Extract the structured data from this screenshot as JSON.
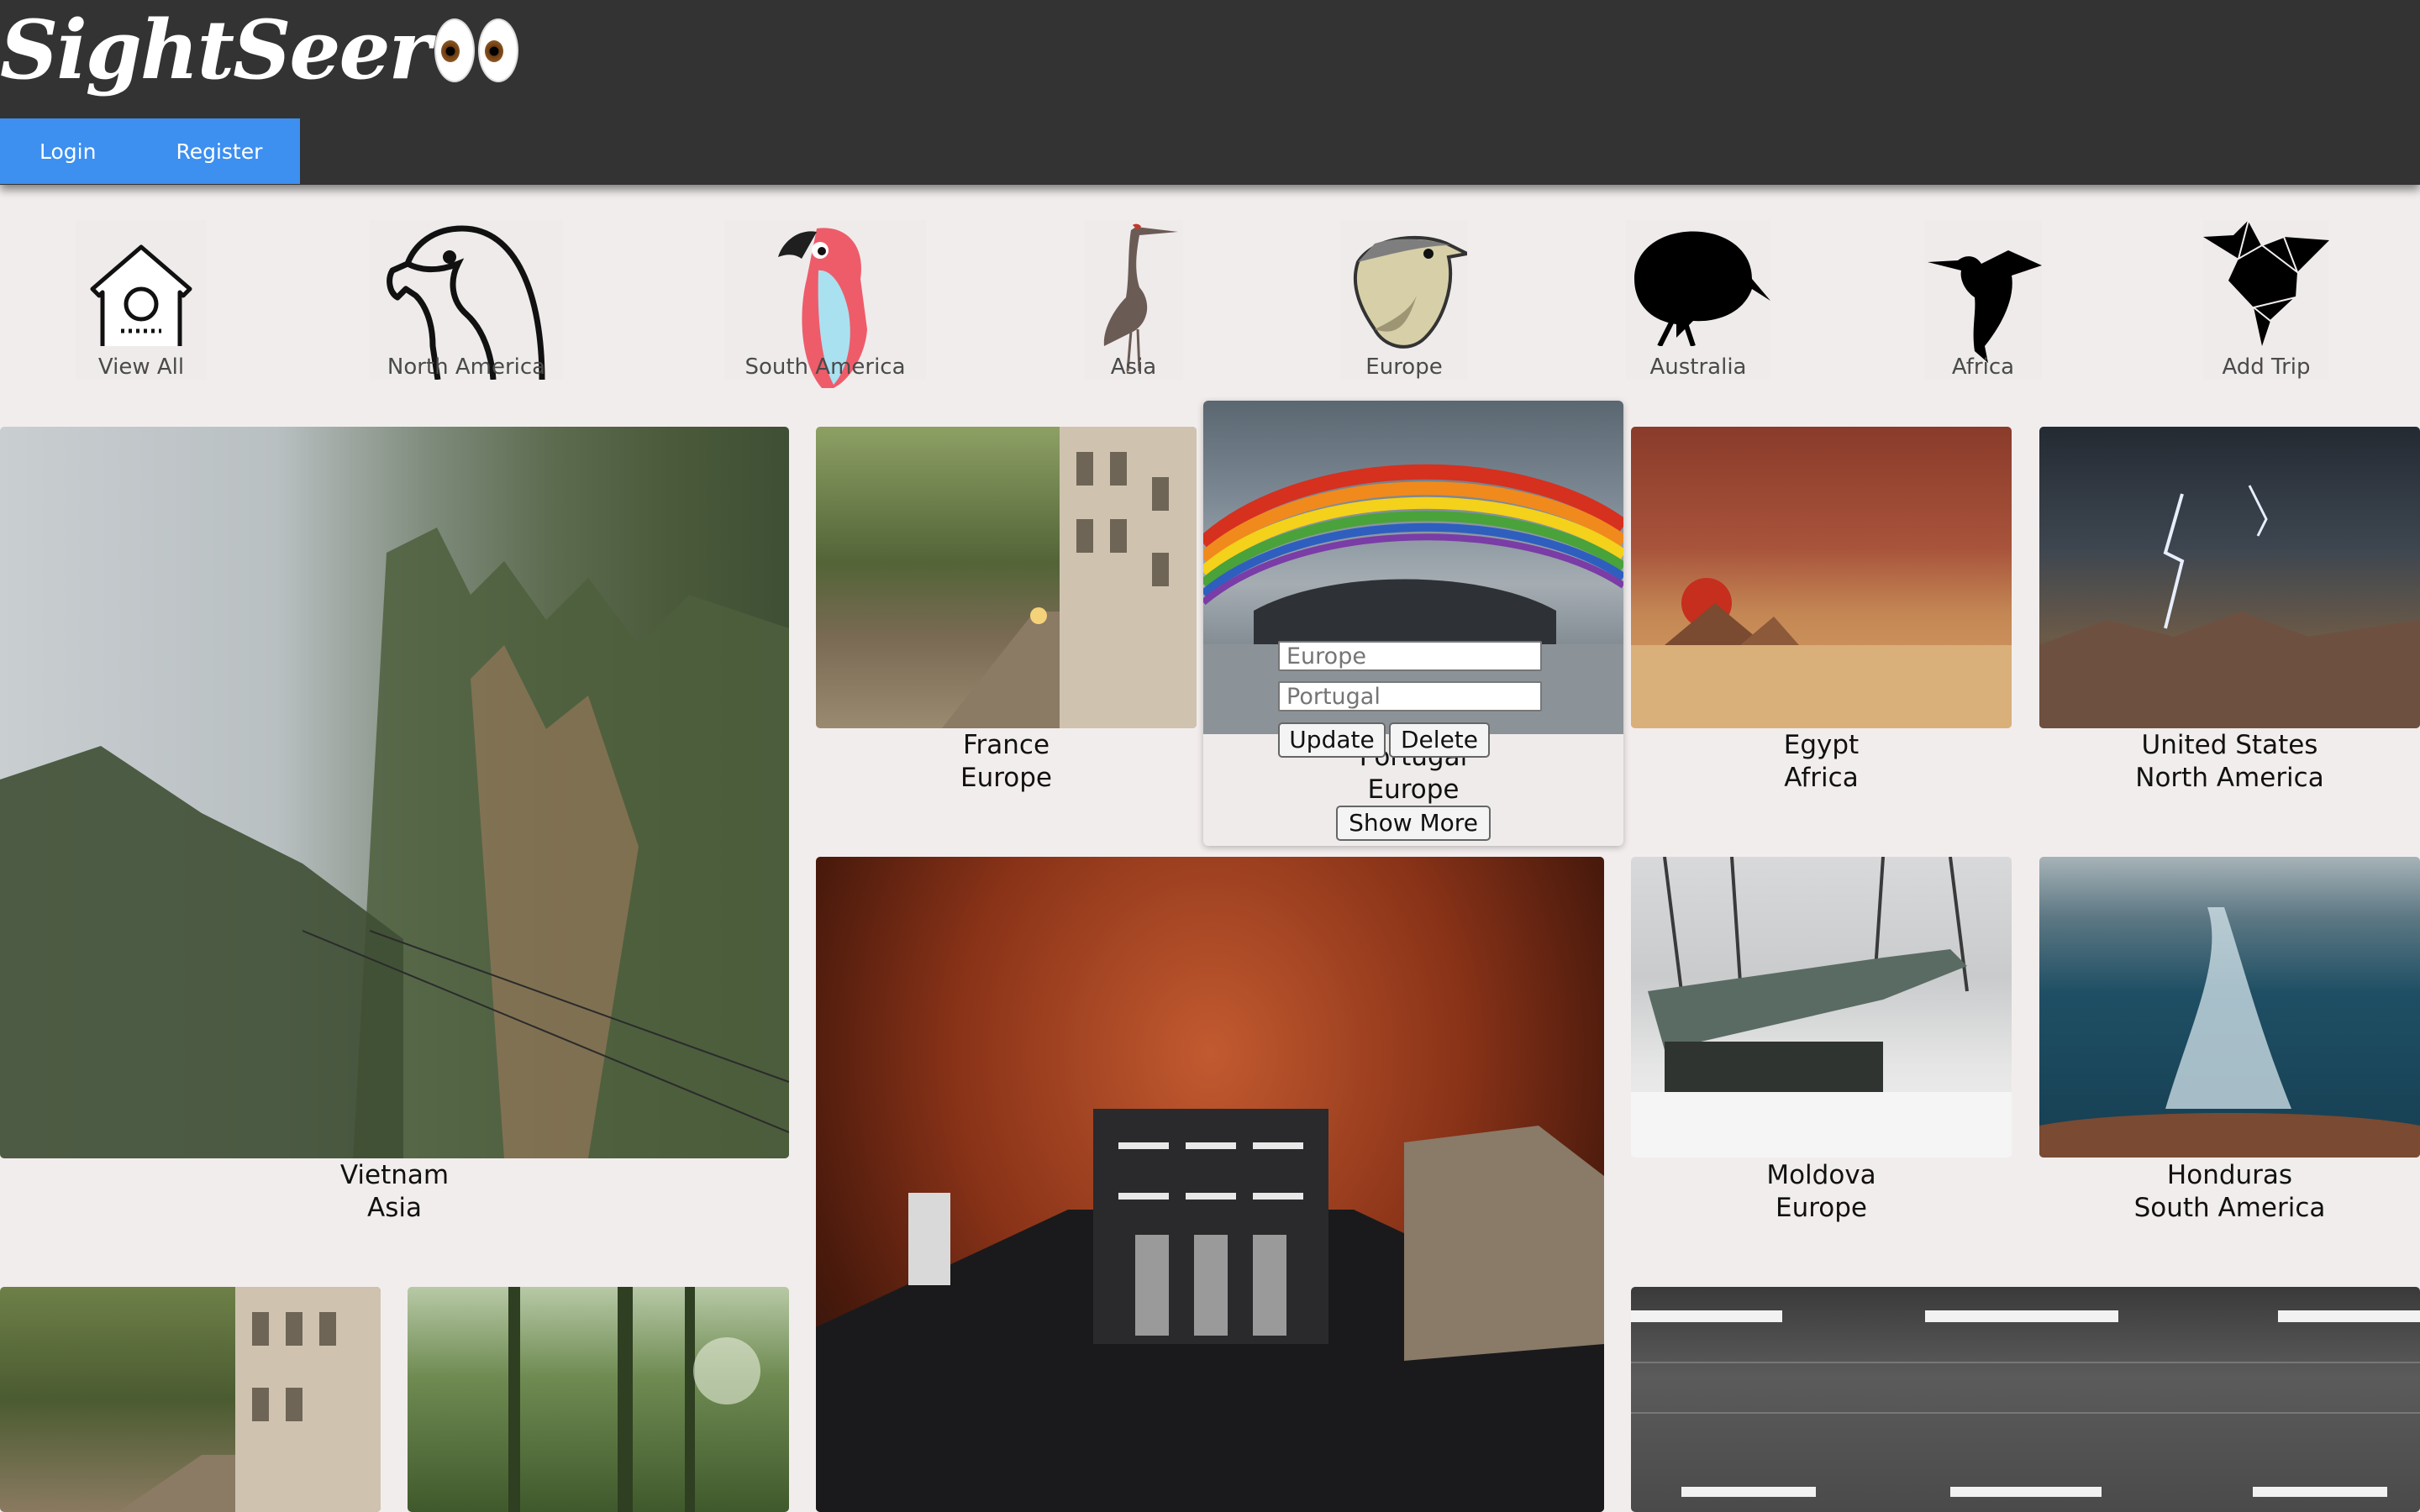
{
  "app": {
    "title": "SightSeer"
  },
  "nav": {
    "login": "Login",
    "register": "Register"
  },
  "categories": [
    {
      "label": "View All",
      "icon": "birdhouse-icon"
    },
    {
      "label": "North America",
      "icon": "eagle-icon"
    },
    {
      "label": "South America",
      "icon": "parrot-icon"
    },
    {
      "label": "Asia",
      "icon": "crane-icon"
    },
    {
      "label": "Europe",
      "icon": "sparrow-icon"
    },
    {
      "label": "Australia",
      "icon": "kiwi-icon"
    },
    {
      "label": "Africa",
      "icon": "hummingbird-icon"
    },
    {
      "label": "Add Trip",
      "icon": "origami-bird-icon"
    }
  ],
  "cards": [
    {
      "country": "Vietnam",
      "continent": "Asia"
    },
    {
      "country": "France",
      "continent": "Europe"
    },
    {
      "country": "Portugal",
      "continent": "Europe"
    },
    {
      "country": "Egypt",
      "continent": "Africa"
    },
    {
      "country": "United States",
      "continent": "North America"
    },
    {
      "country": "Moldova",
      "continent": "Europe"
    },
    {
      "country": "Honduras",
      "continent": "South America"
    }
  ],
  "edit_form": {
    "continent_placeholder": "Europe",
    "country_placeholder": "Portugal",
    "update_label": "Update",
    "delete_label": "Delete",
    "show_more_label": "Show More"
  }
}
